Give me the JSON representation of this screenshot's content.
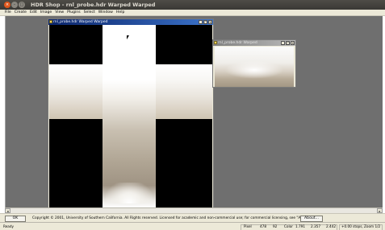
{
  "app": {
    "window_title": "HDR Shop - rnl_probe.hdr Warped Warped",
    "title_buttons": {
      "close": "×",
      "min": "–",
      "max": "□"
    }
  },
  "menu": [
    "File",
    "Create",
    "Edit",
    "Image",
    "View",
    "Plugins",
    "Select",
    "Window",
    "Help"
  ],
  "child_windows": {
    "main_title": "rnl_probe.hdr Warped Warped",
    "secondary_title": "rnl_probe.hdr Warped",
    "window_buttons": [
      "_",
      "□",
      "×"
    ]
  },
  "scrollbar": {
    "left": "◂",
    "right": "▸"
  },
  "infobar": {
    "ok_label": "OK",
    "copyright": "Copyright © 2001, University of Southern California.  All Rights reserved.  Licensed for academic and non-commercial use; for commercial licensing, see \"About\".",
    "about_label": "About..."
  },
  "status": {
    "ready": "Ready",
    "pixel_label": "Pixel",
    "pixel_x": "478",
    "pixel_y": "92",
    "color_label": "Color",
    "color_r": "1.791",
    "color_g": "2.357",
    "color_b": "2.442",
    "stops": "+0.00 stops, Zoom 1/2"
  },
  "colors": {
    "titlebar": "#3f3e3a",
    "workspace": "#6f6f6f",
    "active_title": "#0a246a",
    "close_button": "#e0571c"
  }
}
